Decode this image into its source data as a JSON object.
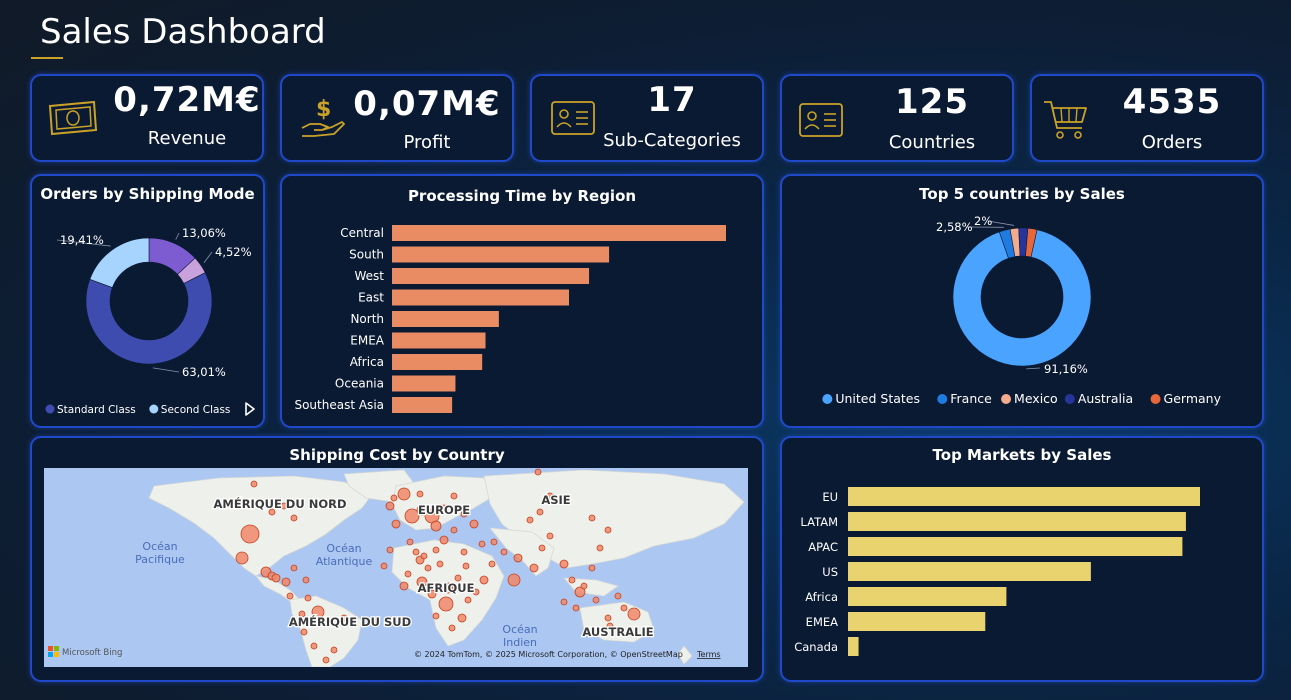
{
  "header": {
    "title": "Sales Dashboard"
  },
  "kpis": [
    {
      "value": "0,72M€",
      "label": "Revenue",
      "icon": "money-icon"
    },
    {
      "value": "0,07M€",
      "label": "Profit",
      "icon": "hand-dollar-icon"
    },
    {
      "value": "17",
      "label": "Sub-Categories",
      "icon": "id-card-icon"
    },
    {
      "value": "125",
      "label": "Countries",
      "icon": "id-card-icon"
    },
    {
      "value": "4535",
      "label": "Orders",
      "icon": "cart-icon"
    }
  ],
  "colors": {
    "card_border": "#1f49c9",
    "bar_orange": "#e98b63",
    "bar_yellow": "#e8d36e",
    "standard_class": "#3e4cb0",
    "second_class": "#a6d3ff",
    "first_class": "#7d5bd1",
    "same_day": "#c8a1dd"
  },
  "chart_data": [
    {
      "id": "shipping-mode",
      "type": "pie",
      "title": "Orders by Shipping Mode",
      "slices": [
        {
          "name": "Standard Class",
          "value": 63.01,
          "label": "63,01%",
          "color": "#3e4cb0"
        },
        {
          "name": "Second Class",
          "value": 19.41,
          "label": "19,41%",
          "color": "#a6d3ff"
        },
        {
          "name": "",
          "value": 13.06,
          "label": "13,06%",
          "color": "#7d5bd1"
        },
        {
          "name": "",
          "value": 4.52,
          "label": "4,52%",
          "color": "#c8a1dd"
        }
      ],
      "legend": [
        "Standard Class",
        "Second Class"
      ],
      "legend_position": "bottom-left"
    },
    {
      "id": "processing-time",
      "type": "bar",
      "orientation": "horizontal",
      "title": "Processing Time by Region",
      "categories": [
        "Central",
        "South",
        "West",
        "East",
        "North",
        "EMEA",
        "Africa",
        "Oceania",
        "Southeast Asia"
      ],
      "values": [
        100,
        65,
        59,
        53,
        32,
        28,
        27,
        19,
        18
      ],
      "xlim": [
        0,
        100
      ],
      "color": "#e98b63",
      "grid": false
    },
    {
      "id": "top-countries",
      "type": "pie",
      "title": "Top 5 countries by Sales",
      "slices": [
        {
          "name": "United States",
          "value": 91.16,
          "label": "91,16%",
          "color": "#4aa3ff"
        },
        {
          "name": "France",
          "value": 2.58,
          "label": "2,58%",
          "color": "#1f7be0"
        },
        {
          "name": "Mexico",
          "value": 2.0,
          "label": "2%",
          "color": "#f4ab8e"
        },
        {
          "name": "Australia",
          "value": 2.13,
          "label": "",
          "color": "#26349c"
        },
        {
          "name": "Germany",
          "value": 2.13,
          "label": "",
          "color": "#e8673a"
        }
      ],
      "legend": [
        "United States",
        "France",
        "Mexico",
        "Australia",
        "Germany"
      ],
      "legend_position": "bottom"
    },
    {
      "id": "top-markets",
      "type": "bar",
      "orientation": "horizontal",
      "title": "Top Markets by Sales",
      "categories": [
        "EU",
        "LATAM",
        "APAC",
        "US",
        "Africa",
        "EMEA",
        "Canada"
      ],
      "values": [
        100,
        96,
        95,
        69,
        45,
        39,
        3
      ],
      "xlim": [
        0,
        100
      ],
      "color": "#e8d36e",
      "grid": false
    }
  ],
  "map": {
    "title": "Shipping Cost by Country",
    "labels": {
      "north_america": "AMÉRIQUE DU NORD",
      "europe": "EUROPE",
      "asia": "ASIE",
      "pacific": "Océan Pacifique",
      "atlantic": "Océan Atlantique",
      "africa": "AFRIQUE",
      "south_america": "AMÉRIQUE DU SUD",
      "indian": "Océan Indien",
      "australia": "AUSTRALIE"
    },
    "brand": "Microsoft Bing",
    "attribution": "© 2024 TomTom, © 2025 Microsoft Corporation, © OpenStreetMap",
    "terms": "Terms"
  }
}
